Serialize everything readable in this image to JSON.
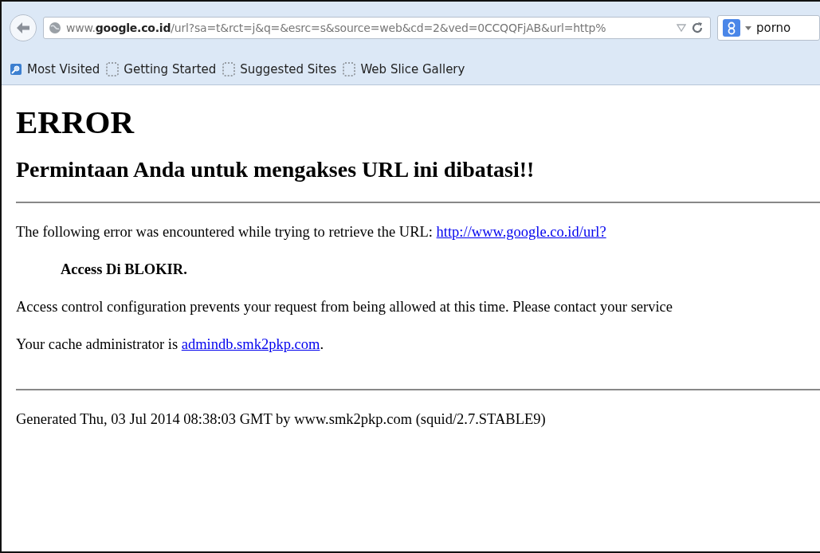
{
  "address_bar": {
    "url": "www.**google.co.id**/url?sa=t&rct=j&q=&esrc=s&source=web&cd=2&ved=0CCQQFjAB&url=http%"
  },
  "search_bar": {
    "value": "porno"
  },
  "bookmarks": [
    {
      "label": "Most Visited",
      "kind": "folder"
    },
    {
      "label": "Getting Started",
      "kind": "page"
    },
    {
      "label": "Suggested Sites",
      "kind": "page"
    },
    {
      "label": "Web Slice Gallery",
      "kind": "page"
    }
  ],
  "page": {
    "title": "ERROR",
    "subtitle": "Permintaan Anda untuk mengakses URL ini dibatasi!!",
    "error_text": "The following error was encountered while trying to retrieve the URL:",
    "error_link": "http://www.google.co.id/url?",
    "reason": "Access Di BLOKIR.",
    "description": "Access control configuration prevents your request from being allowed at this time. Please contact your service",
    "admin_text": "Your cache administrator is",
    "admin_link": "admindb.smk2pkp.com",
    "admin_end": ".",
    "footer": "Generated Thu, 03 Jul 2014 08:38:03 GMT by www.smk2pkp.com (squid/2.7.STABLE9)"
  }
}
